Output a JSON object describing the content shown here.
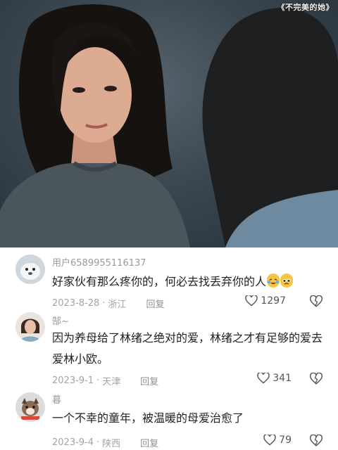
{
  "video": {
    "watermark": "《不完美的她》"
  },
  "comments": [
    {
      "username": "用户6589955116137",
      "text": "好家伙有那么疼你的，何必去找丢弃你的人",
      "date": "2023-8-28",
      "location": "浙江",
      "reply_label": "回复",
      "likes": "1297",
      "emojis": [
        "crying-laughing",
        "pleading-face"
      ]
    },
    {
      "username": "郜~",
      "text": "因为养母给了林绪之绝对的爱，林绪之才有足够的爱去爱林小欧。",
      "date": "2023-9-1",
      "location": "天津",
      "reply_label": "回复",
      "likes": "341"
    },
    {
      "username": "暮",
      "text": "一个不幸的童年，被温暖的母爱治愈了",
      "date": "2023-9-4",
      "location": "陕西",
      "reply_label": "回复",
      "likes": "79"
    }
  ],
  "separator": "·"
}
